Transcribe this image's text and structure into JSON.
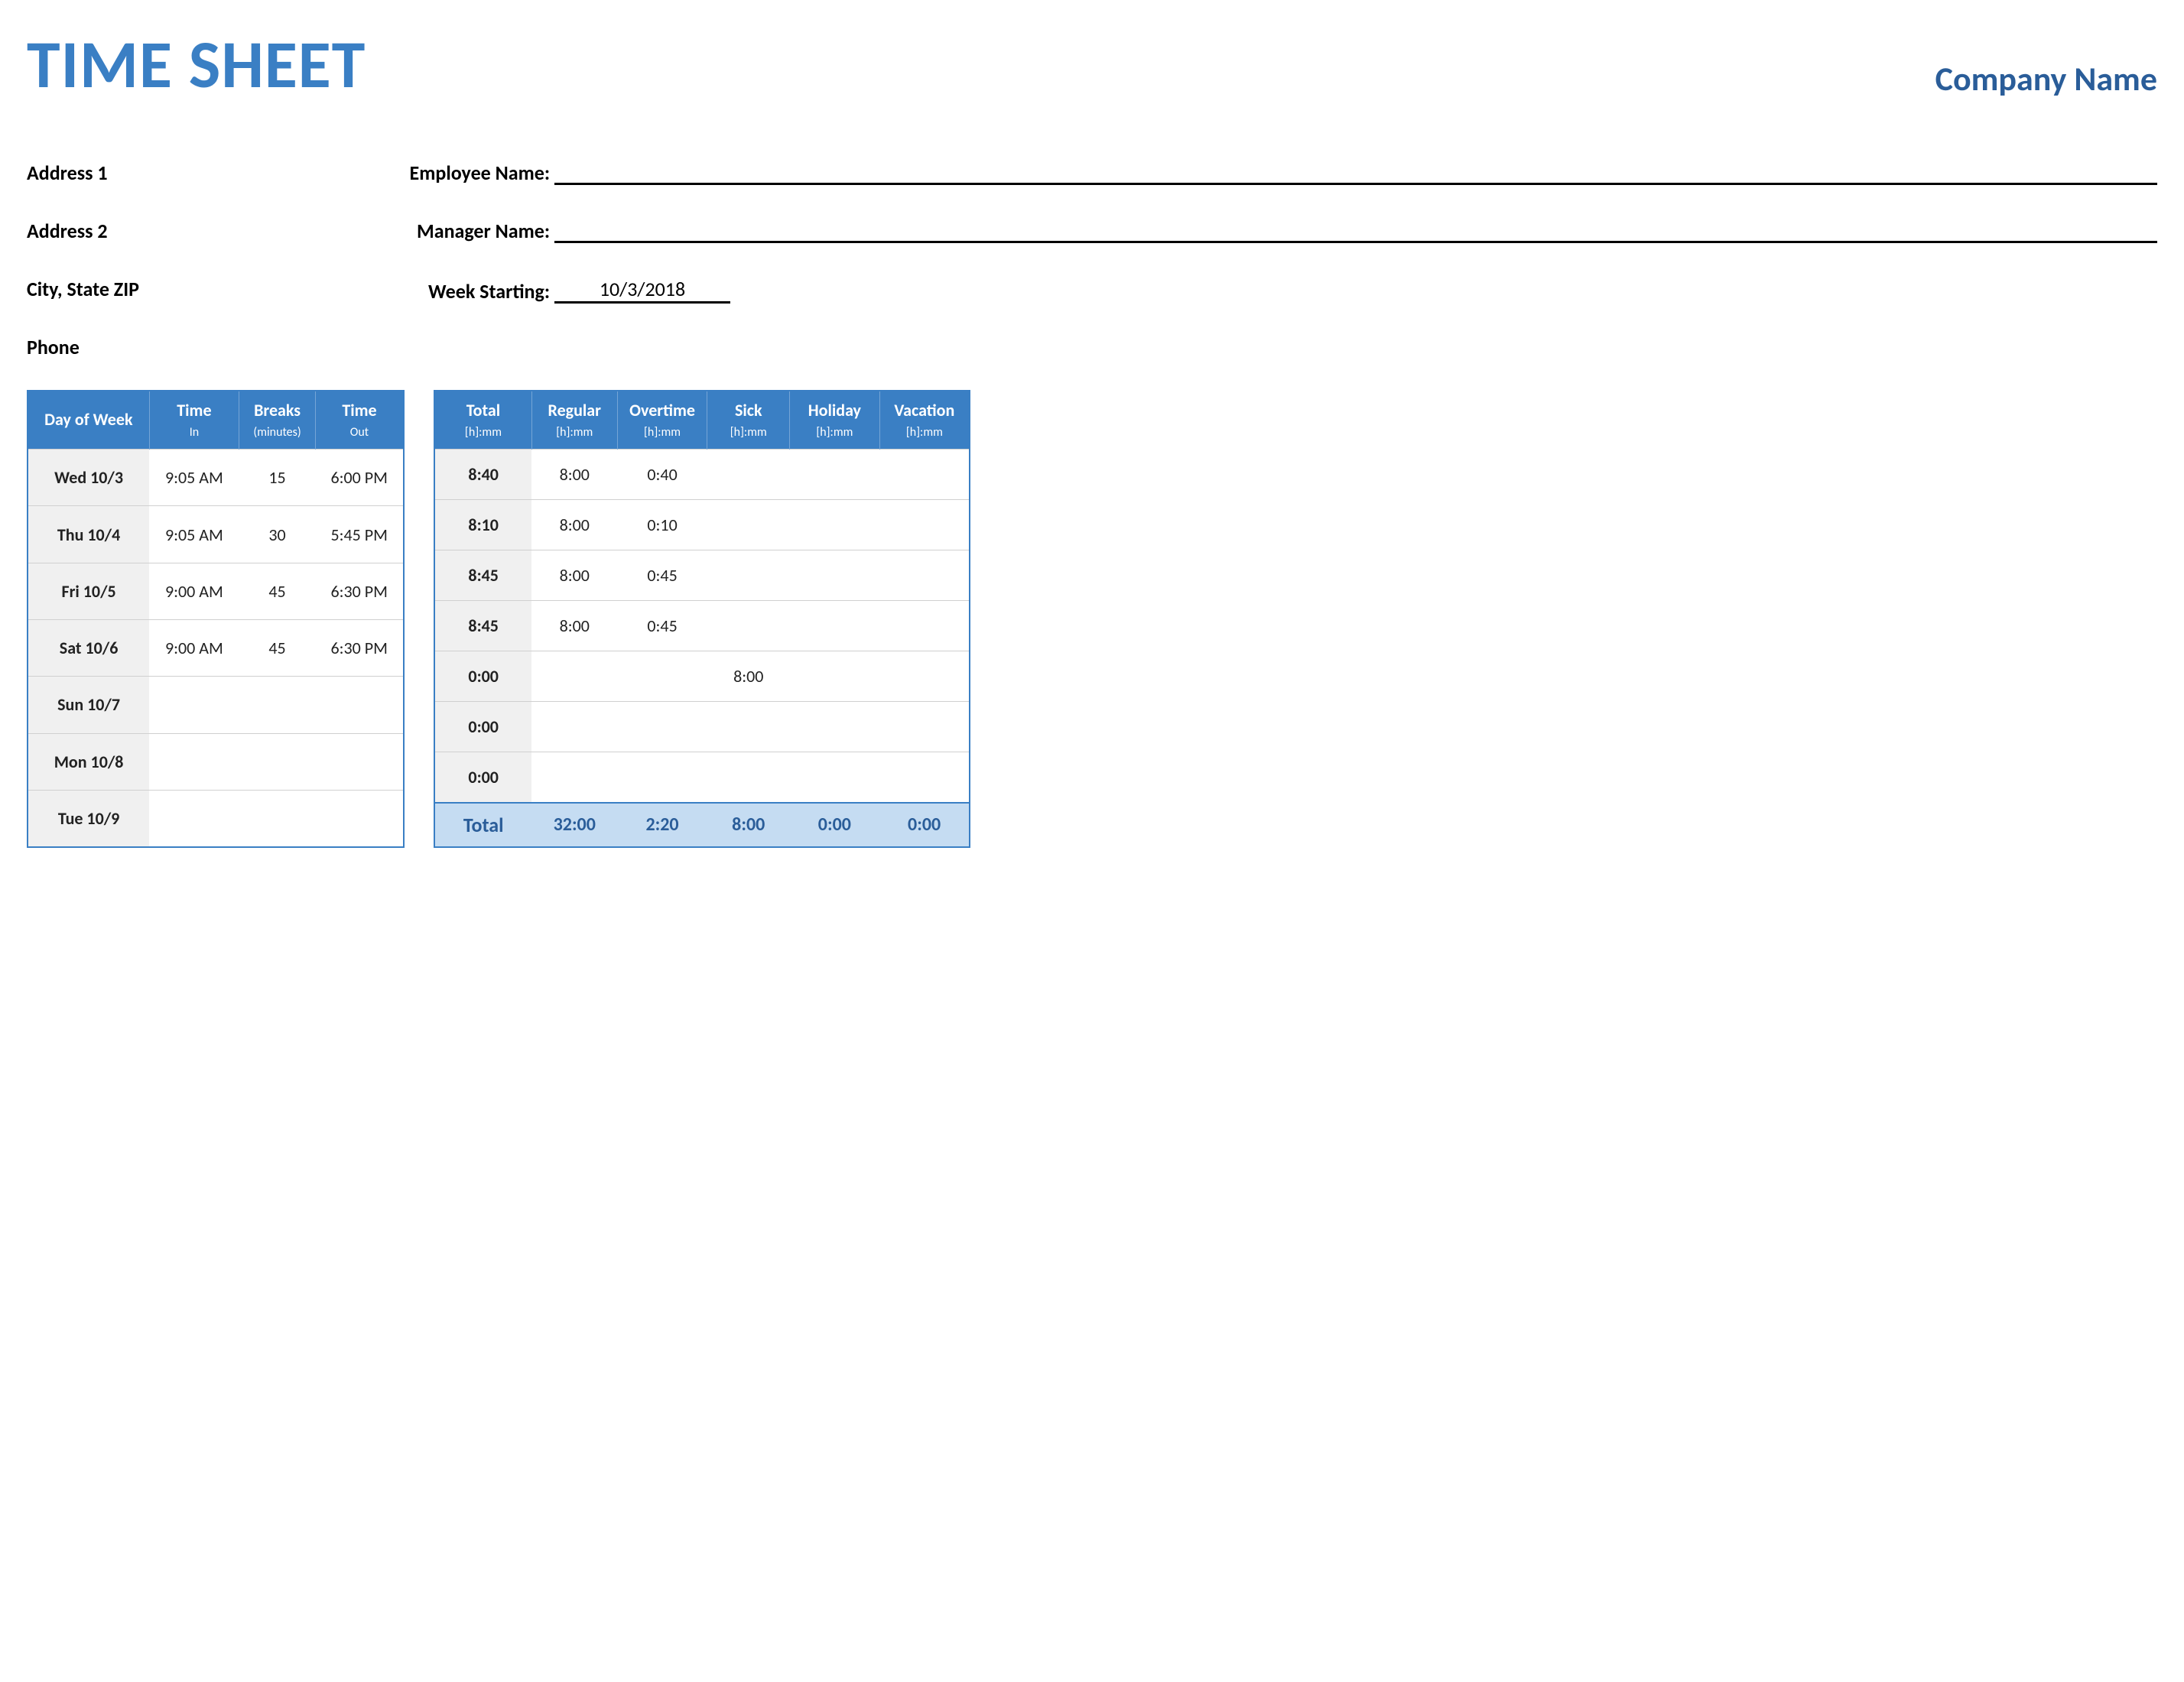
{
  "title": "TIME SHEET",
  "company_name": "Company Name",
  "address_labels": {
    "address1": "Address 1",
    "address2": "Address 2",
    "city_state_zip": "City, State  ZIP",
    "phone": "Phone"
  },
  "form": {
    "employee_label": "Employee Name:",
    "employee_value": "",
    "manager_label": "Manager Name:",
    "manager_value": "",
    "week_starting_label": "Week Starting:",
    "week_starting_value": "10/3/2018"
  },
  "left_headers": {
    "day": "Day of Week",
    "time_in": "Time",
    "time_in_sub": "In",
    "breaks": "Breaks",
    "breaks_sub": "(minutes)",
    "time_out": "Time",
    "time_out_sub": "Out"
  },
  "right_headers": {
    "total": "Total",
    "total_sub": "[h]:mm",
    "regular": "Regular",
    "regular_sub": "[h]:mm",
    "overtime": "Overtime",
    "overtime_sub": "[h]:mm",
    "sick": "Sick",
    "sick_sub": "[h]:mm",
    "holiday": "Holiday",
    "holiday_sub": "[h]:mm",
    "vacation": "Vacation",
    "vacation_sub": "[h]:mm"
  },
  "rows": [
    {
      "day": "Wed 10/3",
      "in": "9:05 AM",
      "breaks": "15",
      "out": "6:00 PM",
      "total": "8:40",
      "regular": "8:00",
      "overtime": "0:40",
      "sick": "",
      "holiday": "",
      "vacation": ""
    },
    {
      "day": "Thu 10/4",
      "in": "9:05 AM",
      "breaks": "30",
      "out": "5:45 PM",
      "total": "8:10",
      "regular": "8:00",
      "overtime": "0:10",
      "sick": "",
      "holiday": "",
      "vacation": ""
    },
    {
      "day": "Fri 10/5",
      "in": "9:00 AM",
      "breaks": "45",
      "out": "6:30 PM",
      "total": "8:45",
      "regular": "8:00",
      "overtime": "0:45",
      "sick": "",
      "holiday": "",
      "vacation": ""
    },
    {
      "day": "Sat 10/6",
      "in": "9:00 AM",
      "breaks": "45",
      "out": "6:30 PM",
      "total": "8:45",
      "regular": "8:00",
      "overtime": "0:45",
      "sick": "",
      "holiday": "",
      "vacation": ""
    },
    {
      "day": "Sun 10/7",
      "in": "",
      "breaks": "",
      "out": "",
      "total": "0:00",
      "regular": "",
      "overtime": "",
      "sick": "8:00",
      "holiday": "",
      "vacation": ""
    },
    {
      "day": "Mon 10/8",
      "in": "",
      "breaks": "",
      "out": "",
      "total": "0:00",
      "regular": "",
      "overtime": "",
      "sick": "",
      "holiday": "",
      "vacation": ""
    },
    {
      "day": "Tue 10/9",
      "in": "",
      "breaks": "",
      "out": "",
      "total": "0:00",
      "regular": "",
      "overtime": "",
      "sick": "",
      "holiday": "",
      "vacation": ""
    }
  ],
  "totals": {
    "label": "Total",
    "regular": "32:00",
    "overtime": "2:20",
    "sick": "8:00",
    "holiday": "0:00",
    "vacation": "0:00"
  }
}
